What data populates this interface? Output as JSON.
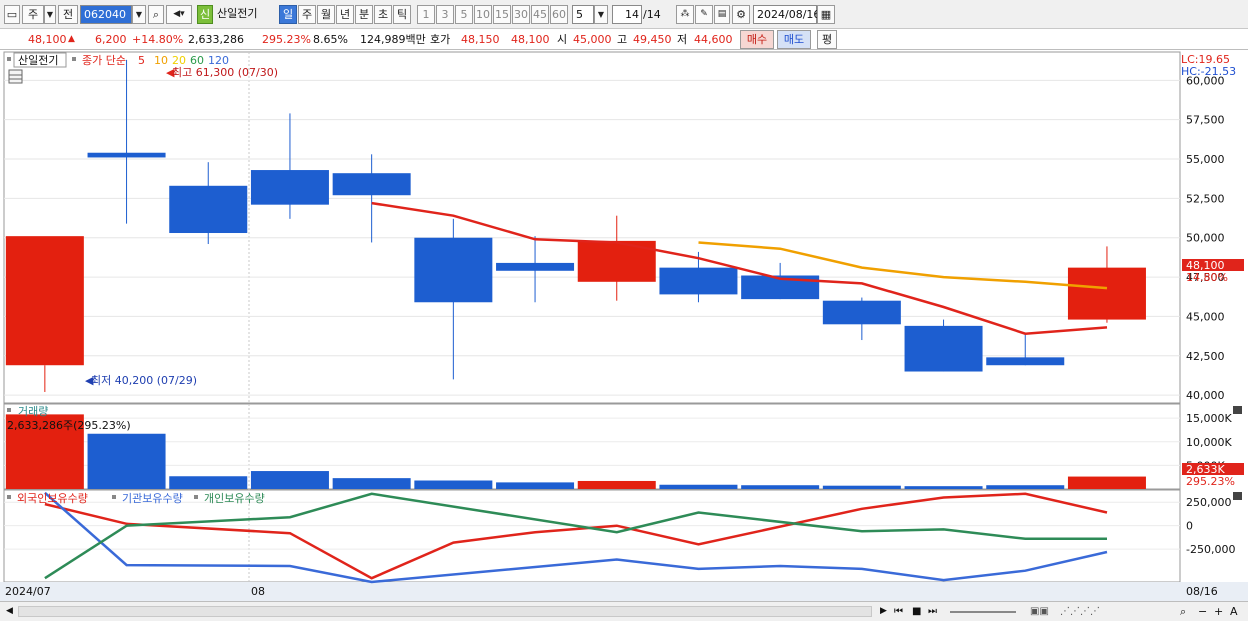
{
  "toolbar": {
    "market": "주",
    "type": "전",
    "code": "062040",
    "stock_name": "산일전기",
    "badge": "신",
    "periods": [
      "일",
      "주",
      "월",
      "년",
      "분",
      "초",
      "틱"
    ],
    "selected_period": "일",
    "intervals": [
      "1",
      "3",
      "5",
      "10",
      "15",
      "30",
      "45",
      "60"
    ],
    "interval_value": "5",
    "count": "14",
    "count_total": "/14",
    "date": "2024/08/16"
  },
  "quote": {
    "price": "48,100",
    "arrow": "▲",
    "change": "6,200",
    "change_pct": "+14.80%",
    "volume": "2,633,286",
    "volume_ratio": "295.23%",
    "turnover": "8.65%",
    "amount": "124,989백만",
    "bid_ask_label": "호가",
    "ask": "48,150",
    "bid": "48,100",
    "open_label": "시",
    "open": "45,000",
    "high_label": "고",
    "high": "49,450",
    "low_label": "저",
    "low": "44,600",
    "buy_label": "매수",
    "sell_label": "매도",
    "avg_label": "평"
  },
  "price_panel": {
    "stock_label": "산일전기",
    "ma_label": "종가 단순",
    "ma_periods": [
      "5",
      "10",
      "20",
      "60",
      "120"
    ],
    "ma_colors": [
      "#e0241b",
      "#f0a000",
      "#f0d000",
      "#2a9a4a",
      "#3a6ad8"
    ],
    "lc_label": "LC:19.65",
    "hc_label": "HC:-21.53",
    "high_note": "최고 61,300 (07/30)",
    "low_note": "최저 40,200 (07/29)",
    "current_price_tag": "48,100",
    "current_pct_tag": "14.80%",
    "y_ticks": [
      "60,000",
      "57,500",
      "55,000",
      "52,500",
      "50,000",
      "47,500",
      "45,000",
      "42,500",
      "40,000"
    ]
  },
  "volume_panel": {
    "title": "거래량",
    "current_note": "2,633,286주(295.23%)",
    "y_ticks": [
      "15,000K",
      "10,000K",
      "5,000K"
    ],
    "current_tag": "2,633K",
    "current_pct_tag": "295.23%"
  },
  "holdings_panel": {
    "series_names": [
      "외국인보유수량",
      "기관보유수량",
      "개인보유수량"
    ],
    "series_colors": [
      "#e0241b",
      "#3a6ad8",
      "#2e8b57"
    ],
    "y_ticks": [
      "250,000",
      "0",
      "-250,000"
    ]
  },
  "x_axis": {
    "labels": [
      "2024/07",
      "08"
    ],
    "last_date": "08/16"
  },
  "chart_data": {
    "type": "candlestick",
    "y_range": [
      39500,
      61800
    ],
    "candles": [
      {
        "o": 41900,
        "h": 41900,
        "l": 40200,
        "c": 50100
      },
      {
        "o": 55400,
        "h": 61300,
        "l": 50900,
        "c": 55100
      },
      {
        "o": 53300,
        "h": 54800,
        "l": 49600,
        "c": 50300
      },
      {
        "o": 54300,
        "h": 57900,
        "l": 51200,
        "c": 52100
      },
      {
        "o": 54100,
        "h": 55300,
        "l": 49700,
        "c": 52700
      },
      {
        "o": 50000,
        "h": 51200,
        "l": 41000,
        "c": 45900
      },
      {
        "o": 48400,
        "h": 50100,
        "l": 45900,
        "c": 47900
      },
      {
        "o": 47200,
        "h": 51400,
        "l": 46000,
        "c": 49800
      },
      {
        "o": 48100,
        "h": 49100,
        "l": 45900,
        "c": 46400
      },
      {
        "o": 47600,
        "h": 48400,
        "l": 46100,
        "c": 46100
      },
      {
        "o": 46000,
        "h": 46200,
        "l": 43500,
        "c": 44500
      },
      {
        "o": 44400,
        "h": 44800,
        "l": 41500,
        "c": 41500
      },
      {
        "o": 42400,
        "h": 43900,
        "l": 41900,
        "c": 41900
      },
      {
        "o": 44800,
        "h": 49450,
        "l": 44600,
        "c": 48100
      }
    ],
    "ma5": [
      null,
      null,
      null,
      null,
      52200,
      51400,
      49900,
      49700,
      48700,
      47400,
      47100,
      45600,
      43900,
      44300
    ],
    "ma10": [
      null,
      null,
      null,
      null,
      null,
      null,
      null,
      null,
      49700,
      49300,
      48100,
      47500,
      47200,
      46800
    ],
    "volume": [
      15800,
      11700,
      2700,
      3800,
      2300,
      1800,
      1400,
      1700,
      900,
      800,
      700,
      600,
      800,
      2633
    ],
    "volume_range": [
      0,
      18000
    ],
    "holdings": {
      "foreign": [
        230000,
        20000,
        null,
        -80000,
        -560000,
        -180000,
        -70000,
        0,
        -200000,
        null,
        180000,
        300000,
        340000,
        140000
      ],
      "institution": [
        350000,
        -420000,
        null,
        -430000,
        -600000,
        null,
        null,
        -360000,
        -460000,
        -430000,
        -460000,
        -580000,
        -480000,
        -280000
      ],
      "individual": [
        -560000,
        0,
        null,
        90000,
        340000,
        null,
        null,
        -70000,
        140000,
        null,
        -60000,
        -40000,
        -140000,
        -140000
      ]
    },
    "holdings_range": [
      -600000,
      380000
    ]
  }
}
